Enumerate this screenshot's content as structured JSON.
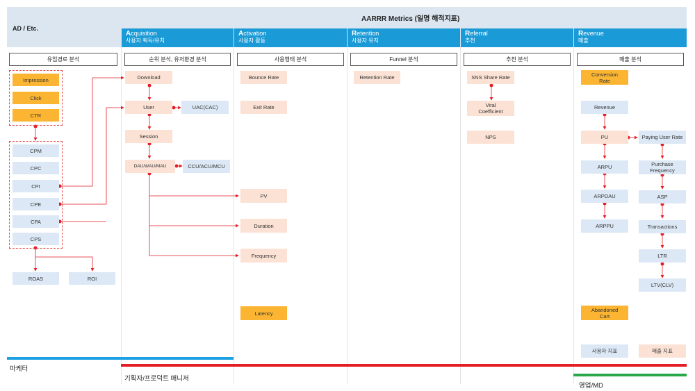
{
  "title": "AARRR Metrics (일명 해적지표)",
  "ad_header": "AD / Etc.",
  "stages": [
    {
      "initial": "A",
      "rest": "cquisition",
      "ko": "사용자 획득/유치"
    },
    {
      "initial": "A",
      "rest": "ctivation",
      "ko": "사용자 활동"
    },
    {
      "initial": "R",
      "rest": "etention",
      "ko": "사용자 유지"
    },
    {
      "initial": "R",
      "rest": "eferral",
      "ko": "추천"
    },
    {
      "initial": "R",
      "rest": "evenue",
      "ko": "매출"
    }
  ],
  "sections": [
    "유입경로 분석",
    "순위 분석, 유저환경 분석",
    "사용행태 분석",
    "Funnel 분석",
    "추천 분석",
    "매출 분석"
  ],
  "ad": {
    "top": [
      "Impression",
      "Click",
      "CTR"
    ],
    "cost": [
      "CPM",
      "CPC",
      "CPI",
      "CPE",
      "CPA",
      "CPS"
    ],
    "roas": "ROAS",
    "roi": "ROI"
  },
  "acq": {
    "download": "Download",
    "user": "User",
    "uac": "UAC(CAC)",
    "session": "Session",
    "dau": "DAU/WAU/MAU",
    "ccu": "CCU/ACU/MCU"
  },
  "act": {
    "bounce": "Bounce Rate",
    "exit": "Exit Rate",
    "pv": "PV",
    "duration": "Duration",
    "frequency": "Frequency",
    "latency": "Latency"
  },
  "ret": {
    "retention": "Retention Rate"
  },
  "ref": {
    "sns": "SNS Share Rate",
    "viral": "Viral Coefficient",
    "nps": "NPS"
  },
  "rev": {
    "conversion": "Conversion Rate",
    "revenue": "Revenue",
    "pu": "PU",
    "arpu": "ARPU",
    "arpdau": "ARPDAU",
    "arppu": "ARPPU",
    "paying": "Paying User Rate",
    "purchase": "Purchase Frequency",
    "asp": "ASP",
    "transactions": "Transactions",
    "ltr": "LTR",
    "ltv": "LTV(CLV)",
    "abandoned": "Abandoned Cart"
  },
  "legend": {
    "user": "사용자 지표",
    "revenue": "매출 지표"
  },
  "roles": {
    "marketer": "마케터",
    "planner": "기획자/프로덕트 매니저",
    "sales": "영업/MD"
  },
  "colors": {
    "header_blue": "#1a9ad6",
    "header_light": "#dbe6f1",
    "orange": "#fbb532",
    "peach": "#fbe2d5",
    "box_blue": "#dce8f5",
    "arrow_red": "#e41e26",
    "bar_blue": "#1da1e2",
    "bar_red": "#e41e26",
    "bar_green": "#29a84a"
  }
}
